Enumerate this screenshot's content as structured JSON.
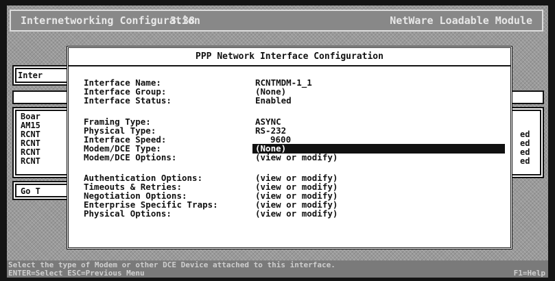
{
  "header": {
    "title": "Internetworking Configuration",
    "version": "3.38",
    "module": "NetWare Loadable Module"
  },
  "background": {
    "panel_title_fragment": "Inter",
    "board_header_fragment": "Boar",
    "board_rows": [
      "AM15",
      "RCNT",
      "RCNT",
      "RCNT",
      "RCNT"
    ],
    "status_fragments": [
      "ed",
      "ed",
      "ed",
      "ed"
    ],
    "go_fragment": "Go T"
  },
  "dialog": {
    "title": "PPP Network Interface Configuration",
    "fields": [
      {
        "label": "Interface Name:",
        "value": "RCNTMDM-1_1"
      },
      {
        "label": "Interface Group:",
        "value": "(None)"
      },
      {
        "label": "Interface Status:",
        "value": "Enabled"
      },
      {
        "label": "Framing Type:",
        "value": "ASYNC"
      },
      {
        "label": "Physical Type:",
        "value": "RS-232"
      },
      {
        "label": "Interface Speed:",
        "value": "9600"
      },
      {
        "label": "Modem/DCE Type:",
        "value": "(None)"
      },
      {
        "label": "Modem/DCE Options:",
        "value": "(view or modify)"
      },
      {
        "label": "Authentication Options:",
        "value": "(view or modify)"
      },
      {
        "label": "Timeouts & Retries:",
        "value": "(view or modify)"
      },
      {
        "label": "Negotiation Options:",
        "value": "(view or modify)"
      },
      {
        "label": "Enterprise Specific Traps:",
        "value": "(view or modify)"
      },
      {
        "label": "Physical Options:",
        "value": "(view or modify)"
      }
    ]
  },
  "status": {
    "line1": "Select the type of Modem or other DCE Device attached to this interface.",
    "line2": "ENTER=Select  ESC=Previous Menu",
    "help": "F1=Help"
  }
}
